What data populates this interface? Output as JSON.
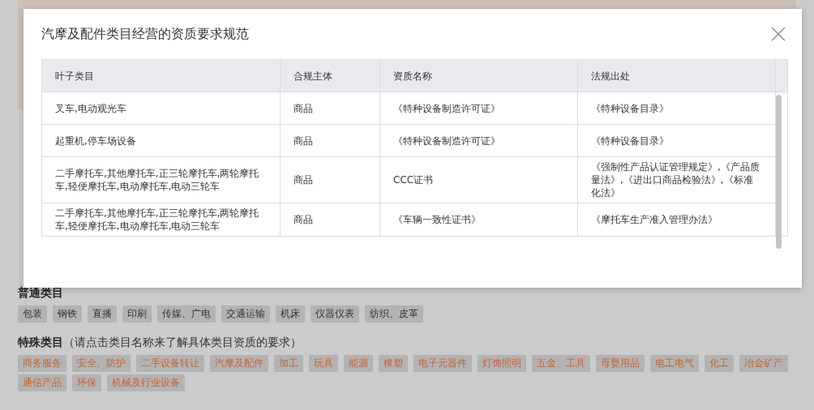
{
  "modal": {
    "title": "汽摩及配件类目经营的资质要求规范",
    "table": {
      "columns": [
        "叶子类目",
        "合规主体",
        "资质名称",
        "法规出处"
      ],
      "rows": [
        [
          "叉车,电动观光车",
          "商品",
          "《特种设备制造许可证》",
          "《特种设备目录》"
        ],
        [
          "起重机,停车场设备",
          "商品",
          "《特种设备制造许可证》",
          "《特种设备目录》"
        ],
        [
          "二手摩托车,其他摩托车,正三轮摩托车,两轮摩托车,轻便摩托车,电动摩托车,电动三轮车",
          "商品",
          "CCC证书",
          "《强制性产品认证管理规定》,《产品质量法》,《进出口商品检验法》,《标准化法》"
        ],
        [
          "二手摩托车,其他摩托车,正三轮摩托车,两轮摩托车,轻便摩托车,电动摩托车,电动三轮车",
          "商品",
          "《车辆一致性证书》",
          "《摩托车生产准入管理办法》"
        ]
      ]
    }
  },
  "general": {
    "heading": "普通类目",
    "tags": [
      "包装",
      "钢铁",
      "直播",
      "印刷",
      "传媒、广电",
      "交通运输",
      "机床",
      "仪器仪表",
      "纺织、皮革"
    ]
  },
  "special": {
    "heading": "特殊类目",
    "hint": "（请点击类目名称来了解具体类目资质的要求）",
    "tags": [
      "商务服务",
      "安全、防护",
      "二手设备转让",
      "汽摩及配件",
      "加工",
      "玩具",
      "能源",
      "橡塑",
      "电子元器件",
      "灯饰照明",
      "五金、工具",
      "母婴用品",
      "电工电气",
      "化工",
      "冶金矿产",
      "通信产品",
      "环保",
      "机械及行业设备"
    ]
  }
}
